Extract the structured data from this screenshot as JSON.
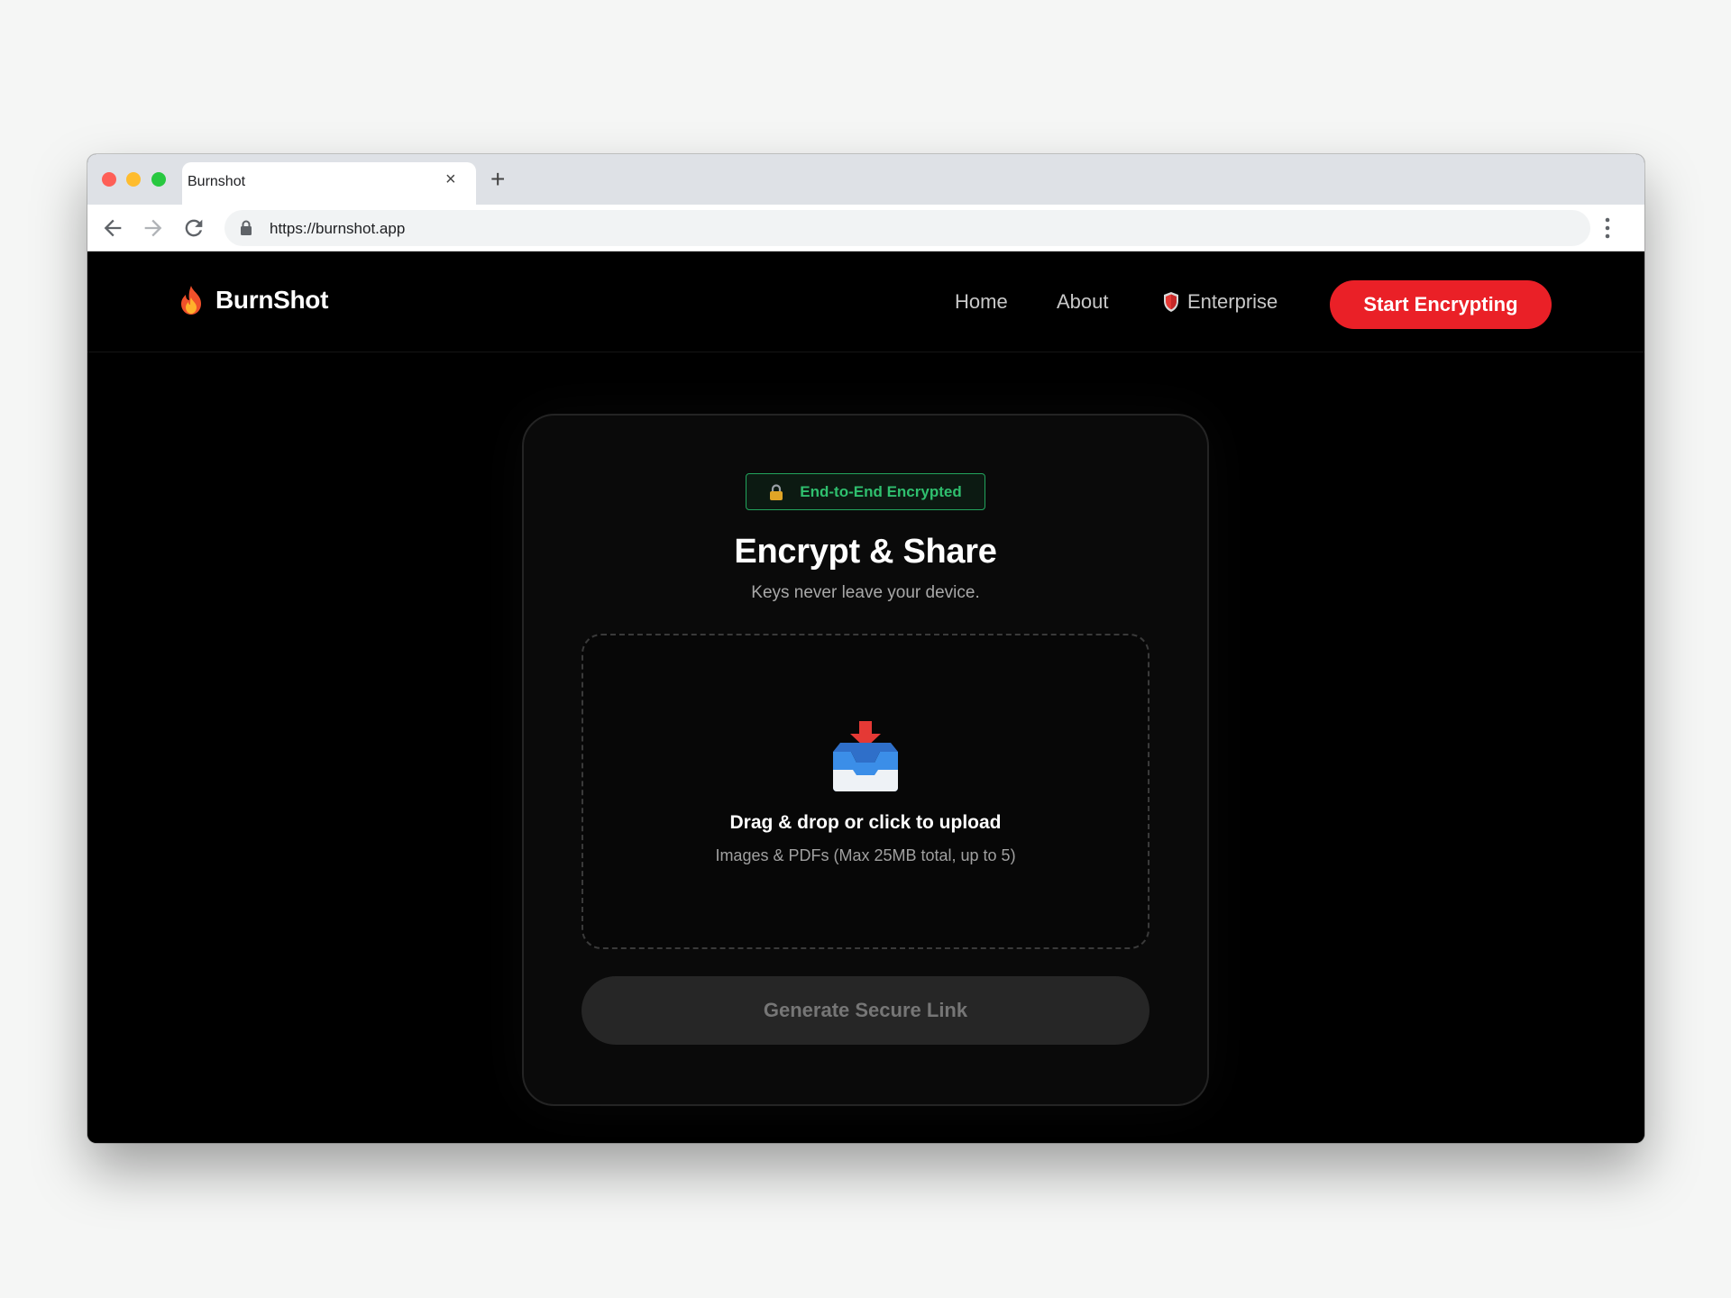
{
  "browser": {
    "tab_title": "Burnshot",
    "tab_close_glyph": "×",
    "new_tab_glyph": "+",
    "url": "https://burnshot.app",
    "icons": [
      "back-arrow-icon",
      "forward-arrow-icon",
      "reload-icon",
      "lock-icon",
      "more-vert-icon"
    ]
  },
  "nav": {
    "brand": "BurnShot",
    "brand_icon": "fire-icon",
    "links": [
      {
        "label": "Home"
      },
      {
        "label": "About"
      },
      {
        "label": "Enterprise",
        "icon": "shield-icon"
      }
    ],
    "cta": "Start Encrypting"
  },
  "card": {
    "badge": "End-to-End Encrypted",
    "badge_icon": "lock-icon",
    "title": "Encrypt & Share",
    "subtitle": "Keys never leave your device.",
    "dropzone": {
      "icon": "inbox-tray-icon",
      "title": "Drag & drop or click to upload",
      "subtitle": "Images & PDFs (Max 25MB total, up to 5)"
    },
    "button": "Generate Secure Link",
    "button_state": "disabled"
  },
  "colors": {
    "accent_red": "#ea2027",
    "badge_green": "#2fbf6e",
    "page_bg": "#000000"
  }
}
